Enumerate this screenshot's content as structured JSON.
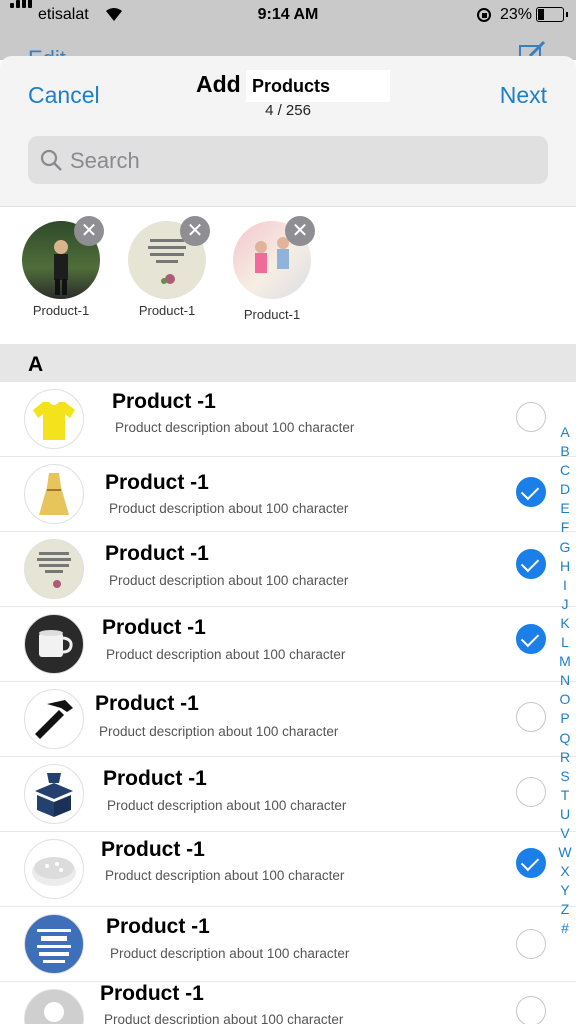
{
  "status": {
    "carrier": "etisalat",
    "time": "9:14 AM",
    "battery": "23%"
  },
  "background": {
    "edit": "Edit"
  },
  "header": {
    "cancel": "Cancel",
    "title": "Add",
    "title_field": "Products",
    "count": "4 / 256",
    "next": "Next"
  },
  "search": {
    "placeholder": "Search"
  },
  "selected": [
    {
      "label": "Product-1"
    },
    {
      "label": "Product-1"
    },
    {
      "label": "Product-1"
    }
  ],
  "section": {
    "letter": "A"
  },
  "products": [
    {
      "name": "Product -1",
      "desc": "Product description about 100 character",
      "checked": false
    },
    {
      "name": "Product -1",
      "desc": "Product description about 100 character",
      "checked": true
    },
    {
      "name": "Product -1",
      "desc": "Product description about 100 character",
      "checked": true
    },
    {
      "name": "Product -1",
      "desc": "Product description about 100 character",
      "checked": true
    },
    {
      "name": "Product -1",
      "desc": "Product description about 100 character",
      "checked": false
    },
    {
      "name": "Product -1",
      "desc": "Product description about 100 character",
      "checked": false
    },
    {
      "name": "Product -1",
      "desc": "Product description about 100 character",
      "checked": true
    },
    {
      "name": "Product -1",
      "desc": "Product description about 100 character",
      "checked": false
    },
    {
      "name": "Product -1",
      "desc": "Product description about 100 character",
      "checked": false
    }
  ],
  "index_letters": [
    "A",
    "B",
    "C",
    "D",
    "E",
    "F",
    "G",
    "H",
    "I",
    "J",
    "K",
    "L",
    "M",
    "N",
    "O",
    "P",
    "Q",
    "R",
    "S",
    "T",
    "U",
    "V",
    "W",
    "X",
    "Y",
    "Z",
    "#"
  ],
  "colors": {
    "accent": "#1e7fc7",
    "check": "#1a7fe8"
  }
}
